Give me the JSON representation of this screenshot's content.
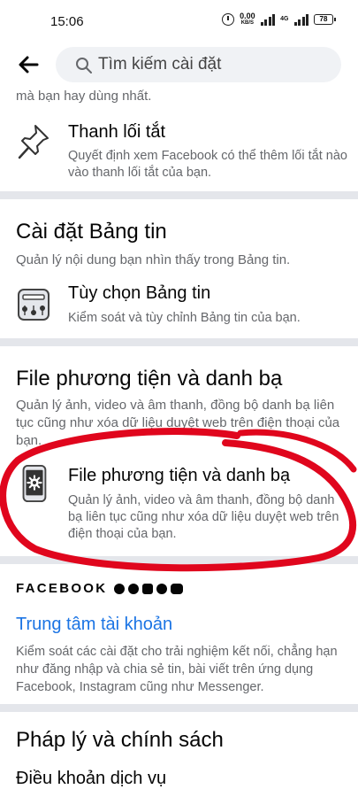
{
  "status_bar": {
    "time": "15:06",
    "speed_value": "0.00",
    "speed_unit": "KB/S",
    "network": "4G",
    "battery": "78"
  },
  "search": {
    "placeholder": "Tìm kiếm cài đặt"
  },
  "partial_text": "mà bạn hay dùng nhất.",
  "shortcuts": {
    "title": "Thanh lối tắt",
    "description": "Quyết định xem Facebook có thể thêm lối tắt nào vào thanh lối tắt của bạn."
  },
  "news_feed_section": {
    "title": "Cài đặt Bảng tin",
    "description": "Quản lý nội dung bạn nhìn thấy trong Bảng tin.",
    "item": {
      "title": "Tùy chọn Bảng tin",
      "description": "Kiểm soát và tùy chỉnh Bảng tin của bạn."
    }
  },
  "media_section": {
    "title": "File phương tiện và danh bạ",
    "description": "Quản lý ảnh, video và âm thanh, đồng bộ danh bạ liên tục cũng như xóa dữ liệu duyệt web trên điện thoại của bạn.",
    "item": {
      "title": "File phương tiện và danh bạ",
      "description": "Quản lý ảnh, video và âm thanh, đồng bộ danh bạ liên tục cũng như xóa dữ liệu duyệt web trên điện thoại của bạn."
    }
  },
  "brand": {
    "wordmark": "FACEBOOK"
  },
  "accounts_center": {
    "title": "Trung tâm tài khoản",
    "description": "Kiểm soát các cài đặt cho trải nghiệm kết nối, chẳng hạn như đăng nhập và chia sẻ tin, bài viết trên ứng dụng Facebook, Instagram cũng như Messenger."
  },
  "legal_section": {
    "title": "Pháp lý và chính sách",
    "terms": "Điều khoản dịch vụ"
  },
  "colors": {
    "link": "#1b74e4",
    "secondary_text": "#65676b",
    "divider": "#e4e6eb",
    "annotation_red": "#e0061d"
  }
}
